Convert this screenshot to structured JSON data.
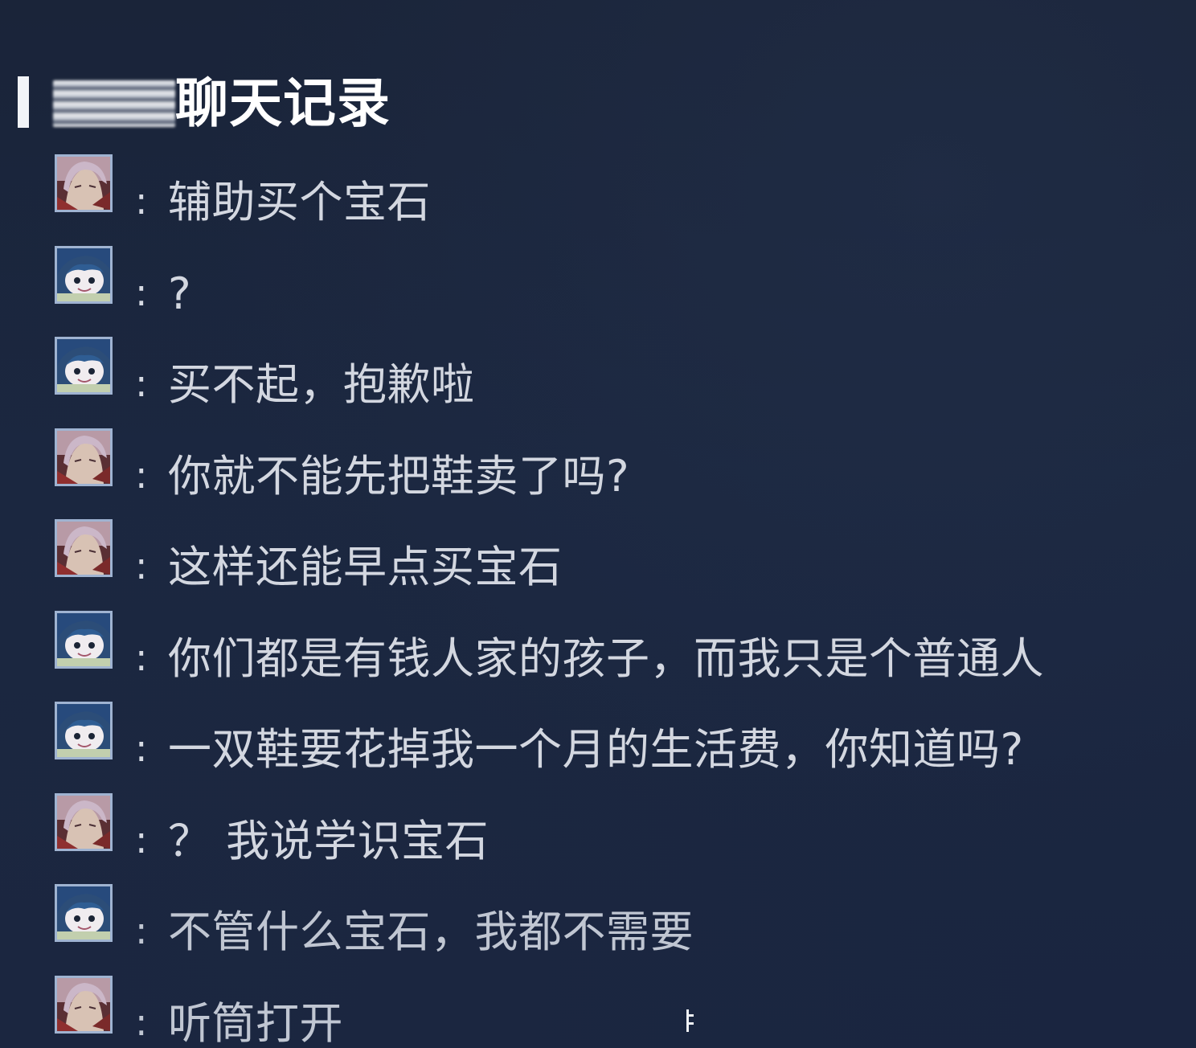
{
  "header": {
    "title": "聊天记录"
  },
  "messages": [
    {
      "avatar": "hero-a-avatar",
      "colon": ":",
      "text": "辅助买个宝石"
    },
    {
      "avatar": "hero-b-avatar",
      "colon": ":",
      "text": "?"
    },
    {
      "avatar": "hero-b-avatar",
      "colon": ":",
      "text": "买不起，抱歉啦"
    },
    {
      "avatar": "hero-a-avatar",
      "colon": ":",
      "text": "你就不能先把鞋卖了吗?"
    },
    {
      "avatar": "hero-a-avatar",
      "colon": ":",
      "text": "这样还能早点买宝石"
    },
    {
      "avatar": "hero-b-avatar",
      "colon": ":",
      "text": "你们都是有钱人家的孩子，而我只是个普通人"
    },
    {
      "avatar": "hero-b-avatar",
      "colon": ":",
      "text": "一双鞋要花掉我一个月的生活费，你知道吗?"
    },
    {
      "avatar": "hero-a-avatar",
      "colon": ":",
      "text": "？ 我说学识宝石"
    },
    {
      "avatar": "hero-b-avatar",
      "colon": ":",
      "text": "不管什么宝石，我都不需要"
    },
    {
      "avatar": "hero-a-avatar",
      "colon": ":",
      "text": "听筒打开"
    }
  ],
  "colors": {
    "background": "#1a2540",
    "text": "#d3d7e0",
    "title": "#ffffff",
    "avatar_border": "#9fb3d1"
  }
}
